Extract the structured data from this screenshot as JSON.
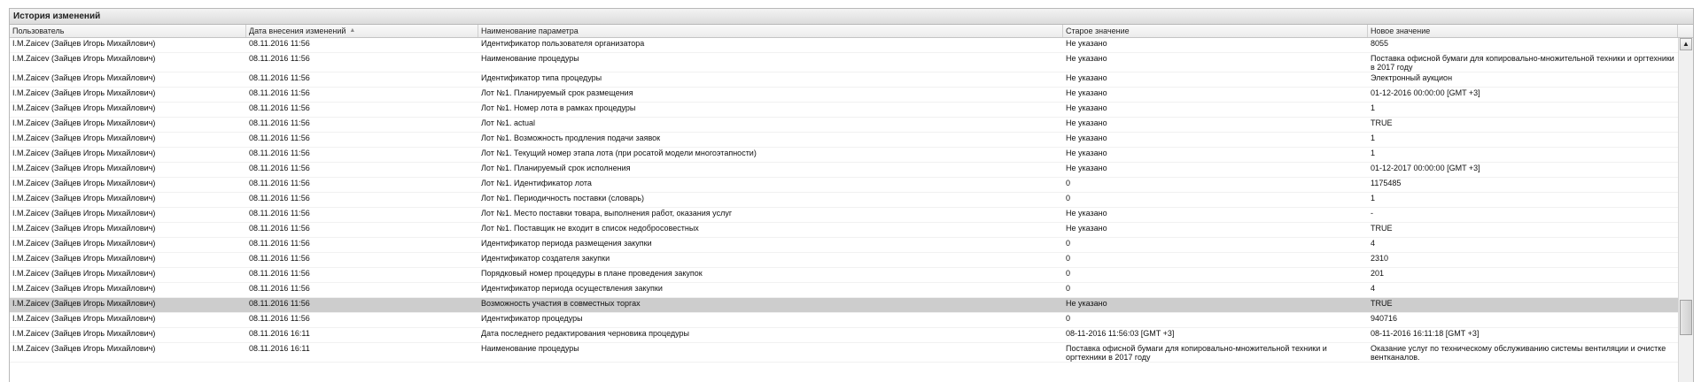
{
  "panel": {
    "title": "История изменений"
  },
  "columns": {
    "user": "Пользователь",
    "date": "Дата внесения изменений",
    "param": "Наименование параметра",
    "old": "Старое значение",
    "new": "Новое значение"
  },
  "icons": {
    "sort": "sort-ascending-icon",
    "scroll_up": "scroll-up-arrow-icon"
  },
  "selected_row": 17,
  "rows": [
    {
      "user": "I.M.Zaicev (Зайцев Игорь Михайлович)",
      "date": "08.11.2016 11:56",
      "param": "Идентификатор пользователя организатора",
      "old": "Не указано",
      "new": "8055"
    },
    {
      "user": "I.M.Zaicev (Зайцев Игорь Михайлович)",
      "date": "08.11.2016 11:56",
      "param": "Наименование процедуры",
      "old": "Не указано",
      "new": "Поставка офисной бумаги для копировально-множительной техники и оргтехники в 2017 году"
    },
    {
      "user": "I.M.Zaicev (Зайцев Игорь Михайлович)",
      "date": "08.11.2016 11:56",
      "param": "Идентификатор типа процедуры",
      "old": "Не указано",
      "new": "Электронный аукцион"
    },
    {
      "user": "I.M.Zaicev (Зайцев Игорь Михайлович)",
      "date": "08.11.2016 11:56",
      "param": "Лот №1. Планируемый срок размещения",
      "old": "Не указано",
      "new": "01-12-2016 00:00:00 [GMT +3]"
    },
    {
      "user": "I.M.Zaicev (Зайцев Игорь Михайлович)",
      "date": "08.11.2016 11:56",
      "param": "Лот №1. Номер лота в рамках процедуры",
      "old": "Не указано",
      "new": "1"
    },
    {
      "user": "I.M.Zaicev (Зайцев Игорь Михайлович)",
      "date": "08.11.2016 11:56",
      "param": "Лот №1. actual",
      "old": "Не указано",
      "new": "TRUE"
    },
    {
      "user": "I.M.Zaicev (Зайцев Игорь Михайлович)",
      "date": "08.11.2016 11:56",
      "param": "Лот №1. Возможность продления подачи заявок",
      "old": "Не указано",
      "new": "1"
    },
    {
      "user": "I.M.Zaicev (Зайцев Игорь Михайлович)",
      "date": "08.11.2016 11:56",
      "param": "Лот №1. Текущий номер этапа лота (при росатой модели многоэтапности)",
      "old": "Не указано",
      "new": "1"
    },
    {
      "user": "I.M.Zaicev (Зайцев Игорь Михайлович)",
      "date": "08.11.2016 11:56",
      "param": "Лот №1. Планируемый срок исполнения",
      "old": "Не указано",
      "new": "01-12-2017 00:00:00 [GMT +3]"
    },
    {
      "user": "I.M.Zaicev (Зайцев Игорь Михайлович)",
      "date": "08.11.2016 11:56",
      "param": "Лот №1. Идентификатор лота",
      "old": "0",
      "new": "1175485"
    },
    {
      "user": "I.M.Zaicev (Зайцев Игорь Михайлович)",
      "date": "08.11.2016 11:56",
      "param": "Лот №1. Периодичность поставки (словарь)",
      "old": "0",
      "new": "1"
    },
    {
      "user": "I.M.Zaicev (Зайцев Игорь Михайлович)",
      "date": "08.11.2016 11:56",
      "param": "Лот №1. Место поставки товара, выполнения работ, оказания услуг",
      "old": "Не указано",
      "new": "-"
    },
    {
      "user": "I.M.Zaicev (Зайцев Игорь Михайлович)",
      "date": "08.11.2016 11:56",
      "param": "Лот №1. Поставщик не входит в список недобросовестных",
      "old": "Не указано",
      "new": "TRUE"
    },
    {
      "user": "I.M.Zaicev (Зайцев Игорь Михайлович)",
      "date": "08.11.2016 11:56",
      "param": "Идентификатор периода размещения закупки",
      "old": "0",
      "new": "4"
    },
    {
      "user": "I.M.Zaicev (Зайцев Игорь Михайлович)",
      "date": "08.11.2016 11:56",
      "param": "Идентификатор создателя закупки",
      "old": "0",
      "new": "2310"
    },
    {
      "user": "I.M.Zaicev (Зайцев Игорь Михайлович)",
      "date": "08.11.2016 11:56",
      "param": "Порядковый номер процедуры в плане проведения закупок",
      "old": "0",
      "new": "201"
    },
    {
      "user": "I.M.Zaicev (Зайцев Игорь Михайлович)",
      "date": "08.11.2016 11:56",
      "param": "Идентификатор периода осуществления закупки",
      "old": "0",
      "new": "4"
    },
    {
      "user": "I.M.Zaicev (Зайцев Игорь Михайлович)",
      "date": "08.11.2016 11:56",
      "param": "Возможность участия в совместных торгах",
      "old": "Не указано",
      "new": "TRUE"
    },
    {
      "user": "I.M.Zaicev (Зайцев Игорь Михайлович)",
      "date": "08.11.2016 11:56",
      "param": "Идентификатор процедуры",
      "old": "0",
      "new": "940716"
    },
    {
      "user": "I.M.Zaicev (Зайцев Игорь Михайлович)",
      "date": "08.11.2016 16:11",
      "param": "Дата последнего редактирования черновика процедуры",
      "old": "08-11-2016 11:56:03 [GMT +3]",
      "new": "08-11-2016 16:11:18 [GMT +3]"
    },
    {
      "user": "I.M.Zaicev (Зайцев Игорь Михайлович)",
      "date": "08.11.2016 16:11",
      "param": "Наименование процедуры",
      "old": "Поставка офисной бумаги для копировально-множительной техники и оргтехники в 2017 году",
      "new": "Оказание услуг по техническому обслуживанию системы вентиляции и очистке вентканалов."
    }
  ]
}
